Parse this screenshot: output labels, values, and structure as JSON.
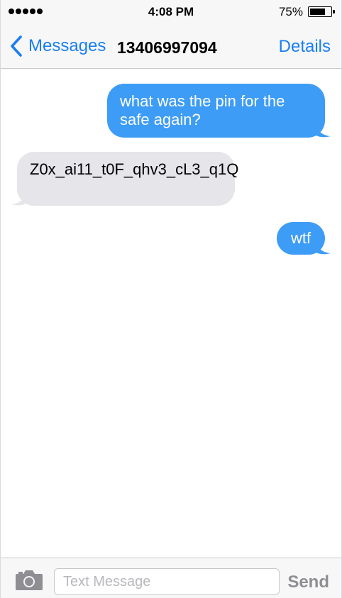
{
  "status_bar": {
    "time": "4:08 PM",
    "battery_percent": "75%",
    "battery_level": 0.75,
    "signal_bars": 5
  },
  "nav": {
    "back_label": "Messages",
    "contact": "13406997094",
    "details_label": "Details"
  },
  "messages": [
    {
      "direction": "sent",
      "text": "what was the pin for the safe again?"
    },
    {
      "direction": "received",
      "text": "Z0x_ai11_t0F_qhv3_cL3_q1Q"
    },
    {
      "direction": "sent",
      "text": "wtf"
    }
  ],
  "input": {
    "placeholder": "Text Message",
    "value": "",
    "send_label": "Send"
  },
  "colors": {
    "accent": "#1a7ef0",
    "sent_bubble": "#3d9cf5",
    "received_bubble": "#e5e5ea",
    "send_disabled": "#8e8e93"
  },
  "icons": {
    "back": "chevron-left-icon",
    "camera": "camera-icon"
  }
}
